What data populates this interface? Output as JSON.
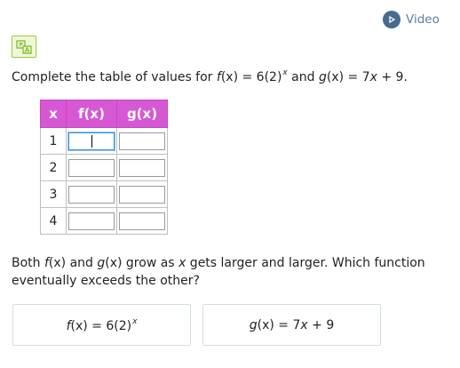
{
  "header": {
    "video_label": "Video"
  },
  "question": {
    "prefix": "Complete the table of values for ",
    "f_name": "f",
    "f_arg": "(x) = 6(2)",
    "f_exp": "x",
    "and": " and ",
    "g_name": "g",
    "g_arg": "(x) = 7",
    "g_var": "x",
    "g_rest": " + 9."
  },
  "table": {
    "headers": [
      "x",
      "f(x)",
      "g(x)"
    ],
    "rows": [
      {
        "x": "1",
        "f": "",
        "g": ""
      },
      {
        "x": "2",
        "f": "",
        "g": ""
      },
      {
        "x": "3",
        "f": "",
        "g": ""
      },
      {
        "x": "4",
        "f": "",
        "g": ""
      }
    ]
  },
  "followup": {
    "p1": "Both ",
    "f": "f",
    "p2": "(x) and ",
    "g": "g",
    "p3": "(x) grow as ",
    "x": "x",
    "p4": " gets larger and larger. Which function eventually exceeds the other?"
  },
  "choices": {
    "a": {
      "name": "f",
      "text": "(x) = 6(2)",
      "exp": "x"
    },
    "b": {
      "name": "g",
      "text": "(x) = 7",
      "var": "x",
      "rest": " + 9"
    }
  },
  "colors": {
    "header_bg": "#d758d5",
    "link": "#5b7fa5",
    "translate_bg": "#eef7dc"
  }
}
